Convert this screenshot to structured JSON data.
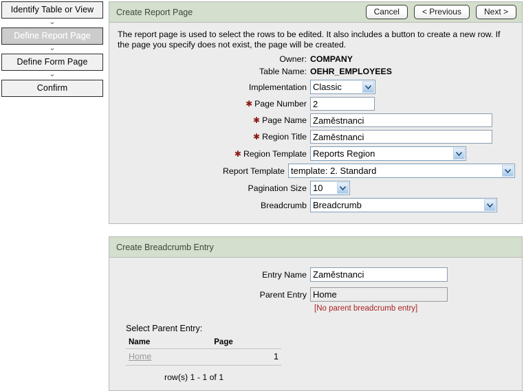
{
  "wizard": {
    "steps": [
      {
        "label": "Identify Table or View",
        "current": false
      },
      {
        "label": "Define Report Page",
        "current": true
      },
      {
        "label": "Define Form Page",
        "current": false
      },
      {
        "label": "Confirm",
        "current": false
      }
    ],
    "arrow_glyph": "⌄"
  },
  "report_panel": {
    "title": "Create Report Page",
    "buttons": {
      "cancel": "Cancel",
      "previous": "< Previous",
      "next": "Next >"
    },
    "intro": "The report page is used to select the rows to be edited. It also includes a button to create a new row. If the page you specify does not exist, the page will be created.",
    "owner_label": "Owner:",
    "owner_value": "COMPANY",
    "table_name_label": "Table Name:",
    "table_name_value": "OEHR_EMPLOYEES",
    "fields": {
      "implementation_label": "Implementation",
      "implementation_value": "Classic",
      "page_number_label": "Page Number",
      "page_number_value": "2",
      "page_name_label": "Page Name",
      "page_name_value": "Zaměstnanci",
      "region_title_label": "Region Title",
      "region_title_value": "Zaměstnanci",
      "region_template_label": "Region Template",
      "region_template_value": "Reports Region",
      "report_template_label": "Report Template",
      "report_template_value": "template: 2. Standard",
      "pagination_size_label": "Pagination Size",
      "pagination_size_value": "10",
      "breadcrumb_label": "Breadcrumb",
      "breadcrumb_value": "Breadcrumb"
    }
  },
  "breadcrumb_panel": {
    "title": "Create Breadcrumb Entry",
    "entry_name_label": "Entry Name",
    "entry_name_value": "Zaměstnanci",
    "parent_entry_label": "Parent Entry",
    "parent_entry_value": "Home",
    "no_parent_note": "[No parent breadcrumb entry]",
    "select_parent_title": "Select Parent Entry:",
    "table": {
      "columns": [
        "Name",
        "Page"
      ],
      "rows": [
        {
          "name": "Home",
          "page": "1"
        }
      ],
      "row_count_text": "row(s) 1 - 1 of 1"
    }
  },
  "colors": {
    "panel_header_green": "#d4dfcd",
    "panel_bg": "#ececec",
    "required_asterisk": "#8b1a12",
    "note_red": "#aa2222",
    "current_step_bg": "#cccccc"
  }
}
